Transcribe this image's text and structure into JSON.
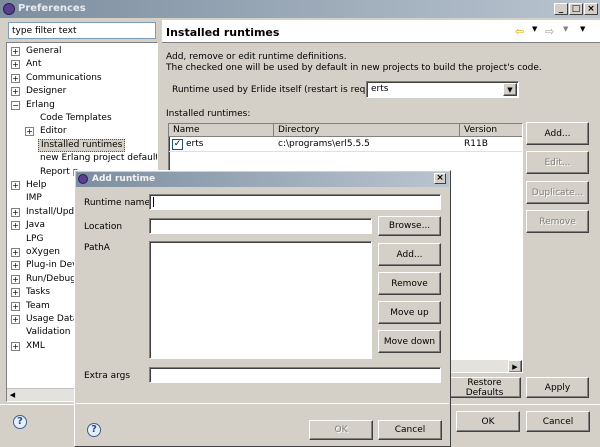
{
  "window": {
    "title": "Preferences"
  },
  "filter": {
    "placeholder": "type filter text"
  },
  "tree": {
    "items": [
      {
        "label": "General",
        "exp": "+"
      },
      {
        "label": "Ant",
        "exp": "+"
      },
      {
        "label": "Communications",
        "exp": "+"
      },
      {
        "label": "Designer",
        "exp": "+"
      },
      {
        "label": "Erlang",
        "exp": "−"
      },
      {
        "label": "Code Templates",
        "exp": ""
      },
      {
        "label": "Editor",
        "exp": "+"
      },
      {
        "label": "Installed runtimes",
        "exp": ""
      },
      {
        "label": "new Erlang project default p",
        "exp": ""
      },
      {
        "label": "Report p",
        "exp": ""
      },
      {
        "label": "Help",
        "exp": "+"
      },
      {
        "label": "IMP",
        "exp": ""
      },
      {
        "label": "Install/Upda",
        "exp": "+"
      },
      {
        "label": "Java",
        "exp": "+"
      },
      {
        "label": "LPG",
        "exp": ""
      },
      {
        "label": "oXygen",
        "exp": "+"
      },
      {
        "label": "Plug-in Deve",
        "exp": "+"
      },
      {
        "label": "Run/Debug",
        "exp": "+"
      },
      {
        "label": "Tasks",
        "exp": "+"
      },
      {
        "label": "Team",
        "exp": "+"
      },
      {
        "label": "Usage Data",
        "exp": "+"
      },
      {
        "label": "Validation",
        "exp": ""
      },
      {
        "label": "XML",
        "exp": "+"
      }
    ]
  },
  "page": {
    "title": "Installed runtimes",
    "desc1": "Add, remove or edit runtime definitions.",
    "desc2": "The checked one will be used by default in new projects to build the project's code.",
    "runtime_label": "Runtime used by Erlide itself (restart is required)",
    "runtime_value": "erts",
    "installed_label": "Installed runtimes:",
    "columns": [
      "Name",
      "Directory",
      "Version"
    ],
    "rows": [
      {
        "name": "erts",
        "dir": "c:\\programs\\erl5.5.5",
        "version": "R11B"
      }
    ],
    "buttons": {
      "add": "Add...",
      "edit": "Edit...",
      "duplicate": "Duplicate...",
      "remove": "Remove"
    },
    "restore": "Restore Defaults",
    "apply": "Apply",
    "ok": "OK",
    "cancel": "Cancel"
  },
  "dialog": {
    "title": "Add runtime",
    "runtime_name": "Runtime name:",
    "location": "Location",
    "browse": "Browse...",
    "patha": "PathA",
    "add": "Add...",
    "remove": "Remove",
    "moveup": "Move up",
    "movedown": "Move down",
    "extra_args": "Extra args",
    "ok": "OK",
    "cancel": "Cancel"
  },
  "help_glyph": "?",
  "colors": {
    "selection": "#d4d0c8",
    "title_gradient_start": "#7d8ea0"
  }
}
